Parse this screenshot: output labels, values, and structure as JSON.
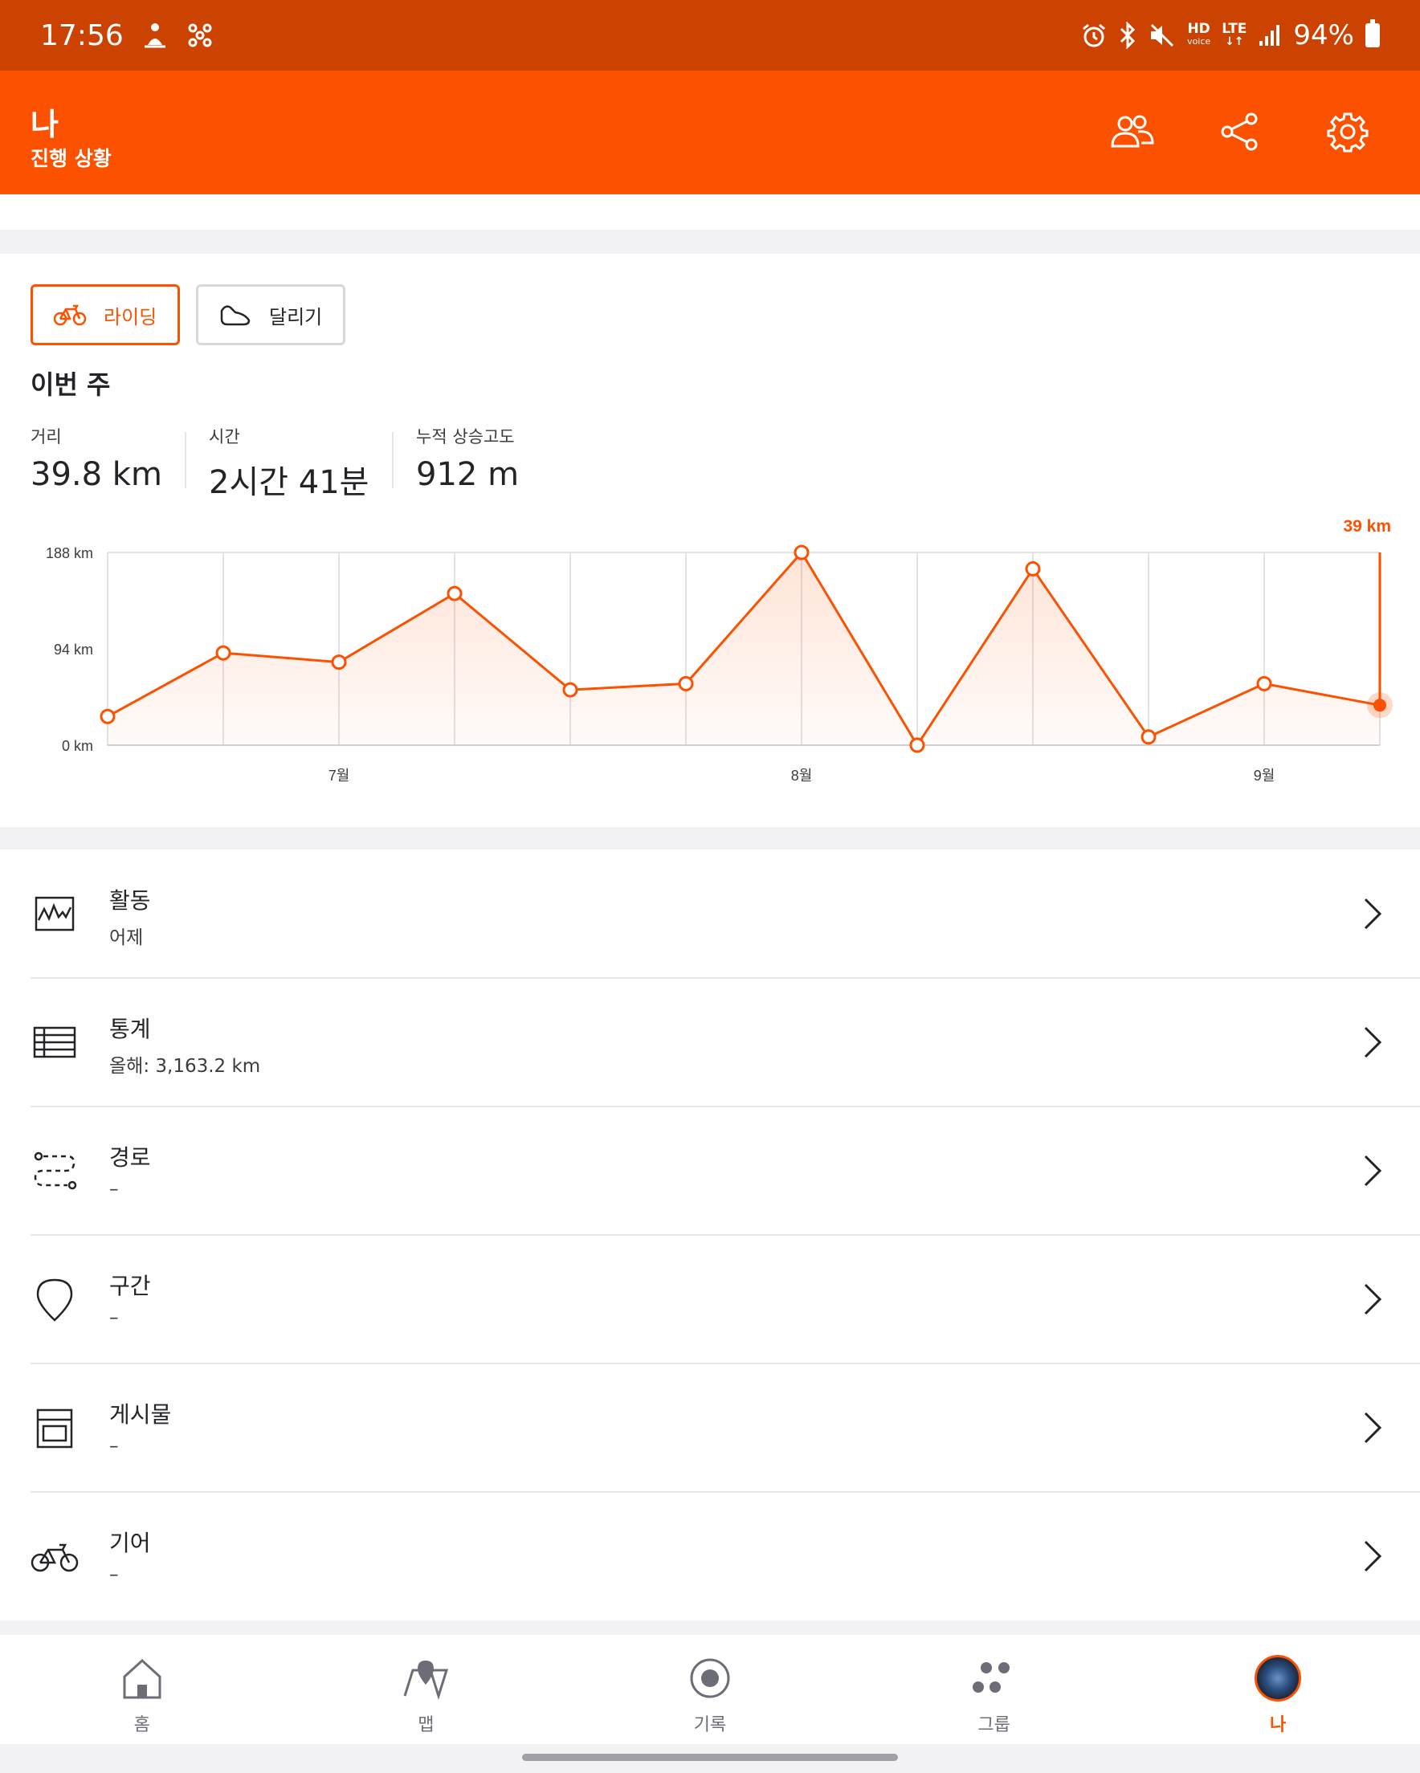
{
  "status_bar": {
    "time": "17:56",
    "hd_label": "HD",
    "voice_label": "voice",
    "lte_label": "LTE",
    "battery": "94%"
  },
  "app_bar": {
    "title": "나",
    "subtitle": "진행 상황"
  },
  "sports": {
    "ride_label": "라이딩",
    "run_label": "달리기"
  },
  "week": {
    "title": "이번 주",
    "stats": [
      {
        "label": "거리",
        "value": "39.8 km"
      },
      {
        "label": "시간",
        "value": "2시간 41분"
      },
      {
        "label": "누적 상승고도",
        "value": "912 m"
      }
    ]
  },
  "chart_data": {
    "type": "line",
    "x": [
      "",
      "",
      "7월",
      "",
      "",
      "",
      "8월",
      "",
      "",
      "",
      "9월",
      ""
    ],
    "values": [
      28,
      90,
      81,
      148,
      54,
      60,
      188,
      0,
      172,
      8,
      60,
      39
    ],
    "ytick_labels": [
      "0 km",
      "94 km",
      "188 km"
    ],
    "yticks": [
      0,
      94,
      188
    ],
    "ylim": [
      0,
      188
    ],
    "current_label": "39 km",
    "grid": true,
    "color": "#fc5200"
  },
  "menu": [
    {
      "title": "활동",
      "sub": "어제",
      "icon": "activity-chart-icon"
    },
    {
      "title": "통계",
      "sub": "올해: 3,163.2 km",
      "icon": "table-icon"
    },
    {
      "title": "경로",
      "sub": "–",
      "icon": "route-icon"
    },
    {
      "title": "구간",
      "sub": "–",
      "icon": "segment-pin-icon"
    },
    {
      "title": "게시물",
      "sub": "–",
      "icon": "post-icon"
    },
    {
      "title": "기어",
      "sub": "–",
      "icon": "bike-icon"
    }
  ],
  "bottom_nav": [
    {
      "label": "홈",
      "icon": "home-icon"
    },
    {
      "label": "맵",
      "icon": "map-icon"
    },
    {
      "label": "기록",
      "icon": "record-icon"
    },
    {
      "label": "그룹",
      "icon": "groups-icon"
    },
    {
      "label": "나",
      "icon": "avatar"
    }
  ],
  "colors": {
    "status_bar": "#cc4200",
    "brand": "#fc5200",
    "text": "#242428"
  }
}
